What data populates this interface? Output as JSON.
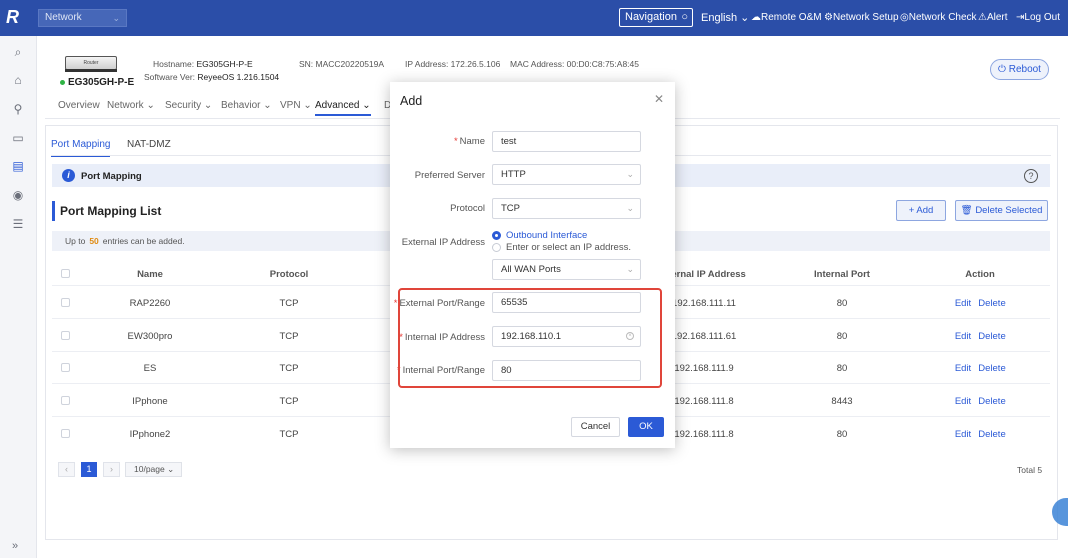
{
  "topbar": {
    "logo": "R",
    "network_select": "Network",
    "navigation_label": "Navigation",
    "language": "English",
    "items": [
      "Remote O&M",
      "Network Setup",
      "Network Check",
      "Alert",
      "Log Out"
    ]
  },
  "device": {
    "image_label": "Router",
    "name": "EG305GH-P-E",
    "hostname_label": "Hostname:",
    "hostname": "EG305GH-P-E",
    "software_label": "Software Ver:",
    "software": "ReyeeOS 1.216.1504",
    "sn": "SN: MACC20220519A",
    "ip": "IP Address: 172.26.5.106",
    "mac": "MAC Address: 00:D0:C8:75:A8:45",
    "reboot_label": "Reboot"
  },
  "menu": [
    "Overview",
    "Network",
    "Security",
    "Behavior",
    "VPN",
    "Advanced",
    "D"
  ],
  "subtabs": [
    "Port Mapping",
    "NAT-DMZ"
  ],
  "info_title": "Port Mapping",
  "list": {
    "title": "Port Mapping List",
    "add_label": "+ Add",
    "delete_label": "Delete Selected",
    "limit_prefix": "Up to",
    "limit_num": "50",
    "limit_suffix": "entries can be added.",
    "headers": [
      "Name",
      "Protocol",
      "ternal IP Address",
      "Internal Port",
      "Action"
    ],
    "rows": [
      {
        "name": "RAP2260",
        "protocol": "TCP",
        "ip": "192.168.111.11",
        "port": "80"
      },
      {
        "name": "EW300pro",
        "protocol": "TCP",
        "ip": "192.168.111.61",
        "port": "80"
      },
      {
        "name": "ES",
        "protocol": "TCP",
        "ip": "192.168.111.9",
        "port": "80"
      },
      {
        "name": "IPphone",
        "protocol": "TCP",
        "ip": "192.168.111.8",
        "port": "8443"
      },
      {
        "name": "IPphone2",
        "protocol": "TCP",
        "ip": "192.168.111.8",
        "port": "80"
      }
    ],
    "edit_label": "Edit",
    "delete_row_label": "Delete"
  },
  "pager": {
    "current": "1",
    "page_size": "10/page",
    "total": "Total 5"
  },
  "modal": {
    "title": "Add",
    "name_label": "Name",
    "name_value": "test",
    "preferred_label": "Preferred Server",
    "preferred_value": "HTTP",
    "protocol_label": "Protocol",
    "protocol_value": "TCP",
    "ext_ip_label": "External IP Address",
    "radio_outbound": "Outbound Interface",
    "radio_enter": "Enter or select an IP address.",
    "wan_value": "All WAN Ports",
    "ext_port_label": "External Port/Range",
    "ext_port_value": "65535",
    "int_ip_label": "Internal IP Address",
    "int_ip_value": "192.168.110.1",
    "int_port_label": "Internal Port/Range",
    "int_port_value": "80",
    "cancel_label": "Cancel",
    "ok_label": "OK"
  },
  "colors": {
    "brand": "#2b4ea8",
    "accent": "#2b5ad6",
    "highlight": "#e0453a"
  }
}
